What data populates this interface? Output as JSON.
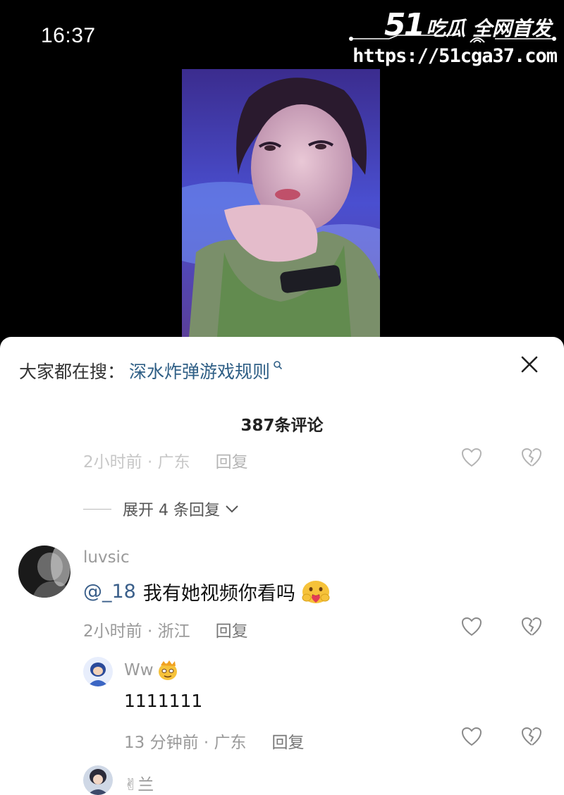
{
  "status_bar": {
    "time": "16:37"
  },
  "watermark": {
    "line1_num": "51",
    "line1_text": "吃瓜 全网首发",
    "url": "https://51cga37.com"
  },
  "sheet": {
    "search_prefix": "大家都在搜：",
    "search_term": "深水炸弹游戏规则",
    "comment_count": "387条评论",
    "partial_meta": "2小时前 · 广东",
    "reply_label": "回复",
    "expand_label": "展开 4 条回复",
    "comments": [
      {
        "user": "luvsic",
        "mention": "@_18",
        "text": "我有她视频你看吗",
        "meta": "2小时前 · 浙江",
        "reply": "回复"
      },
      {
        "user": "Ww",
        "text": "1111111",
        "meta": "13 分钟前 · 广东",
        "reply": "回复"
      },
      {
        "user": "✌兰"
      }
    ]
  },
  "colors": {
    "link": "#2f5f86",
    "mention": "#3a5f8a",
    "meta": "#9a9a9a"
  },
  "icons": [
    "search-icon",
    "close-icon",
    "heart-icon",
    "broken-heart-icon",
    "chevron-down-icon",
    "emoji-icon"
  ]
}
